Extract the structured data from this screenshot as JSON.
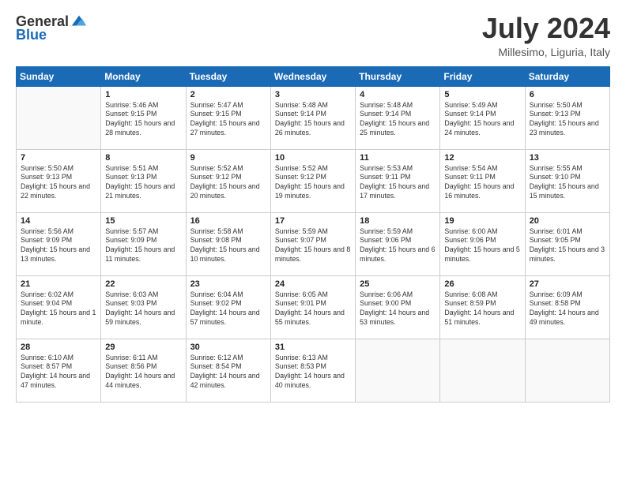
{
  "header": {
    "logo_general": "General",
    "logo_blue": "Blue",
    "main_title": "July 2024",
    "subtitle": "Millesimo, Liguria, Italy"
  },
  "calendar": {
    "headers": [
      "Sunday",
      "Monday",
      "Tuesday",
      "Wednesday",
      "Thursday",
      "Friday",
      "Saturday"
    ],
    "weeks": [
      [
        {
          "day": "",
          "sunrise": "",
          "sunset": "",
          "daylight": ""
        },
        {
          "day": "1",
          "sunrise": "Sunrise: 5:46 AM",
          "sunset": "Sunset: 9:15 PM",
          "daylight": "Daylight: 15 hours and 28 minutes."
        },
        {
          "day": "2",
          "sunrise": "Sunrise: 5:47 AM",
          "sunset": "Sunset: 9:15 PM",
          "daylight": "Daylight: 15 hours and 27 minutes."
        },
        {
          "day": "3",
          "sunrise": "Sunrise: 5:48 AM",
          "sunset": "Sunset: 9:14 PM",
          "daylight": "Daylight: 15 hours and 26 minutes."
        },
        {
          "day": "4",
          "sunrise": "Sunrise: 5:48 AM",
          "sunset": "Sunset: 9:14 PM",
          "daylight": "Daylight: 15 hours and 25 minutes."
        },
        {
          "day": "5",
          "sunrise": "Sunrise: 5:49 AM",
          "sunset": "Sunset: 9:14 PM",
          "daylight": "Daylight: 15 hours and 24 minutes."
        },
        {
          "day": "6",
          "sunrise": "Sunrise: 5:50 AM",
          "sunset": "Sunset: 9:13 PM",
          "daylight": "Daylight: 15 hours and 23 minutes."
        }
      ],
      [
        {
          "day": "7",
          "sunrise": "Sunrise: 5:50 AM",
          "sunset": "Sunset: 9:13 PM",
          "daylight": "Daylight: 15 hours and 22 minutes."
        },
        {
          "day": "8",
          "sunrise": "Sunrise: 5:51 AM",
          "sunset": "Sunset: 9:13 PM",
          "daylight": "Daylight: 15 hours and 21 minutes."
        },
        {
          "day": "9",
          "sunrise": "Sunrise: 5:52 AM",
          "sunset": "Sunset: 9:12 PM",
          "daylight": "Daylight: 15 hours and 20 minutes."
        },
        {
          "day": "10",
          "sunrise": "Sunrise: 5:52 AM",
          "sunset": "Sunset: 9:12 PM",
          "daylight": "Daylight: 15 hours and 19 minutes."
        },
        {
          "day": "11",
          "sunrise": "Sunrise: 5:53 AM",
          "sunset": "Sunset: 9:11 PM",
          "daylight": "Daylight: 15 hours and 17 minutes."
        },
        {
          "day": "12",
          "sunrise": "Sunrise: 5:54 AM",
          "sunset": "Sunset: 9:11 PM",
          "daylight": "Daylight: 15 hours and 16 minutes."
        },
        {
          "day": "13",
          "sunrise": "Sunrise: 5:55 AM",
          "sunset": "Sunset: 9:10 PM",
          "daylight": "Daylight: 15 hours and 15 minutes."
        }
      ],
      [
        {
          "day": "14",
          "sunrise": "Sunrise: 5:56 AM",
          "sunset": "Sunset: 9:09 PM",
          "daylight": "Daylight: 15 hours and 13 minutes."
        },
        {
          "day": "15",
          "sunrise": "Sunrise: 5:57 AM",
          "sunset": "Sunset: 9:09 PM",
          "daylight": "Daylight: 15 hours and 11 minutes."
        },
        {
          "day": "16",
          "sunrise": "Sunrise: 5:58 AM",
          "sunset": "Sunset: 9:08 PM",
          "daylight": "Daylight: 15 hours and 10 minutes."
        },
        {
          "day": "17",
          "sunrise": "Sunrise: 5:59 AM",
          "sunset": "Sunset: 9:07 PM",
          "daylight": "Daylight: 15 hours and 8 minutes."
        },
        {
          "day": "18",
          "sunrise": "Sunrise: 5:59 AM",
          "sunset": "Sunset: 9:06 PM",
          "daylight": "Daylight: 15 hours and 6 minutes."
        },
        {
          "day": "19",
          "sunrise": "Sunrise: 6:00 AM",
          "sunset": "Sunset: 9:06 PM",
          "daylight": "Daylight: 15 hours and 5 minutes."
        },
        {
          "day": "20",
          "sunrise": "Sunrise: 6:01 AM",
          "sunset": "Sunset: 9:05 PM",
          "daylight": "Daylight: 15 hours and 3 minutes."
        }
      ],
      [
        {
          "day": "21",
          "sunrise": "Sunrise: 6:02 AM",
          "sunset": "Sunset: 9:04 PM",
          "daylight": "Daylight: 15 hours and 1 minute."
        },
        {
          "day": "22",
          "sunrise": "Sunrise: 6:03 AM",
          "sunset": "Sunset: 9:03 PM",
          "daylight": "Daylight: 14 hours and 59 minutes."
        },
        {
          "day": "23",
          "sunrise": "Sunrise: 6:04 AM",
          "sunset": "Sunset: 9:02 PM",
          "daylight": "Daylight: 14 hours and 57 minutes."
        },
        {
          "day": "24",
          "sunrise": "Sunrise: 6:05 AM",
          "sunset": "Sunset: 9:01 PM",
          "daylight": "Daylight: 14 hours and 55 minutes."
        },
        {
          "day": "25",
          "sunrise": "Sunrise: 6:06 AM",
          "sunset": "Sunset: 9:00 PM",
          "daylight": "Daylight: 14 hours and 53 minutes."
        },
        {
          "day": "26",
          "sunrise": "Sunrise: 6:08 AM",
          "sunset": "Sunset: 8:59 PM",
          "daylight": "Daylight: 14 hours and 51 minutes."
        },
        {
          "day": "27",
          "sunrise": "Sunrise: 6:09 AM",
          "sunset": "Sunset: 8:58 PM",
          "daylight": "Daylight: 14 hours and 49 minutes."
        }
      ],
      [
        {
          "day": "28",
          "sunrise": "Sunrise: 6:10 AM",
          "sunset": "Sunset: 8:57 PM",
          "daylight": "Daylight: 14 hours and 47 minutes."
        },
        {
          "day": "29",
          "sunrise": "Sunrise: 6:11 AM",
          "sunset": "Sunset: 8:56 PM",
          "daylight": "Daylight: 14 hours and 44 minutes."
        },
        {
          "day": "30",
          "sunrise": "Sunrise: 6:12 AM",
          "sunset": "Sunset: 8:54 PM",
          "daylight": "Daylight: 14 hours and 42 minutes."
        },
        {
          "day": "31",
          "sunrise": "Sunrise: 6:13 AM",
          "sunset": "Sunset: 8:53 PM",
          "daylight": "Daylight: 14 hours and 40 minutes."
        },
        {
          "day": "",
          "sunrise": "",
          "sunset": "",
          "daylight": ""
        },
        {
          "day": "",
          "sunrise": "",
          "sunset": "",
          "daylight": ""
        },
        {
          "day": "",
          "sunrise": "",
          "sunset": "",
          "daylight": ""
        }
      ]
    ]
  }
}
